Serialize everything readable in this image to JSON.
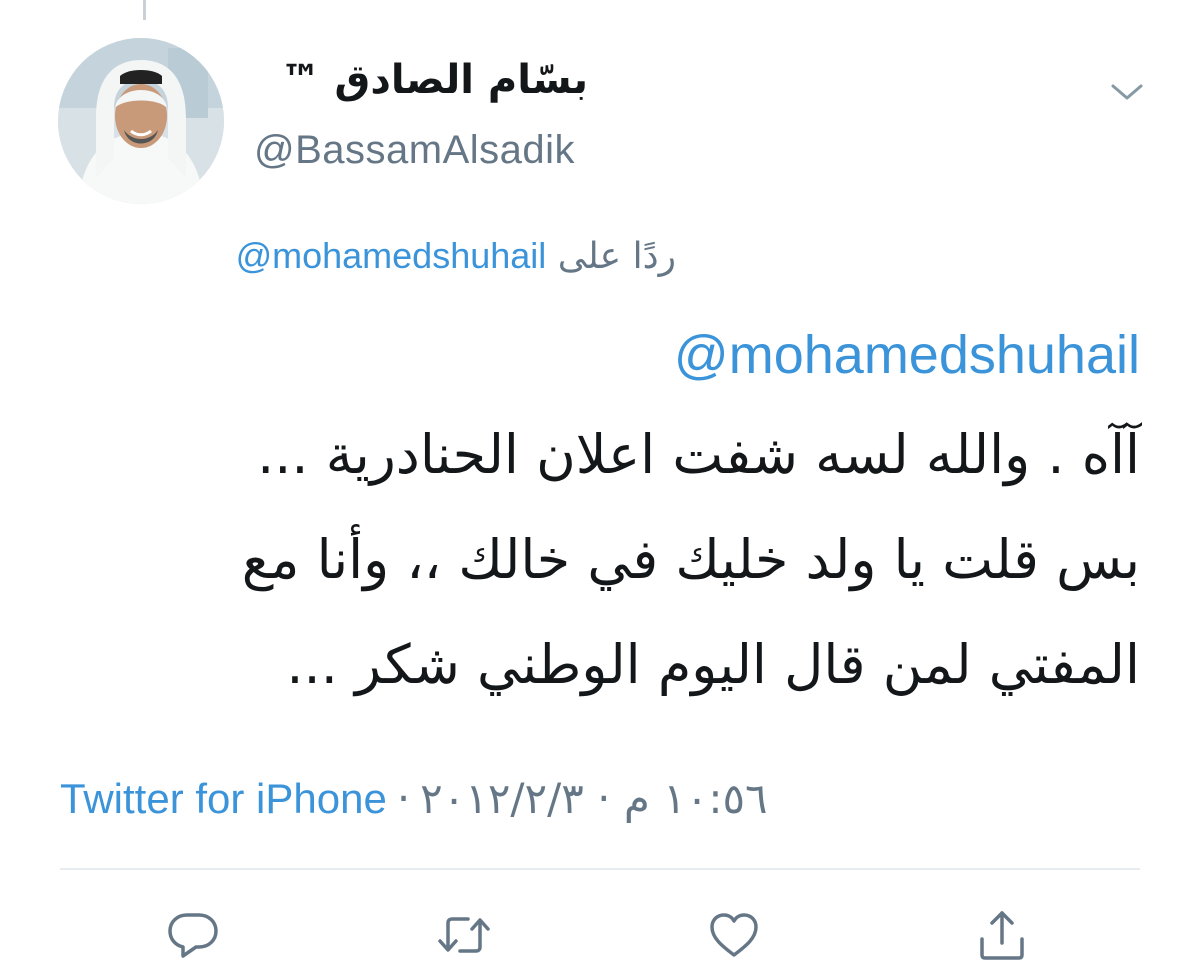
{
  "tweet": {
    "author": {
      "display_name": "بسّام الصادق ™",
      "handle": "@BassamAlsadik"
    },
    "reply_prefix": "ردًا على",
    "reply_to": "@mohamedshuhail",
    "mention": "@mohamedshuhail",
    "body_lines": [
      "آآه . والله لسه شفت اعلان الحنادرية ...",
      "بس قلت يا ولد خليك في خالك ،، وأنا مع",
      "المفتي لمن قال اليوم الوطني شكر ..."
    ],
    "timestamp": "١٠:٥٦ م · ٢٠١٢/٢/٣",
    "separator": "·",
    "source": "Twitter for iPhone"
  },
  "icons": {
    "menu": "chevron-down-icon",
    "reply": "reply-icon",
    "retweet": "retweet-icon",
    "like": "heart-icon",
    "share": "share-icon"
  },
  "colors": {
    "link": "#3b94d9",
    "secondary_text": "#657786",
    "primary_text": "#14171a",
    "icon": "#657786",
    "divider": "#e6ecf0"
  }
}
